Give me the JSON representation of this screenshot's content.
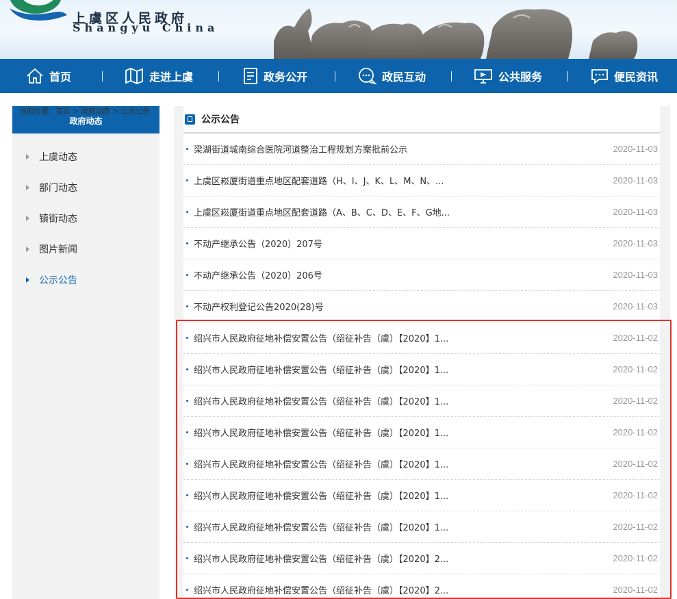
{
  "header": {
    "logo_cn": "上虞区人民政府",
    "logo_en": "Shangyu China"
  },
  "nav": {
    "items": [
      {
        "label": "首页",
        "icon": "home-icon"
      },
      {
        "label": "走进上虞",
        "icon": "map-icon"
      },
      {
        "label": "政务公开",
        "icon": "document-icon"
      },
      {
        "label": "政民互动",
        "icon": "chat-icon"
      },
      {
        "label": "公共服务",
        "icon": "monitor-icon"
      },
      {
        "label": "便民资讯",
        "icon": "message-icon"
      }
    ]
  },
  "breadcrumb": {
    "text": "当前位置：首页 > 政府动态 > 公示公告"
  },
  "sidebar": {
    "title": "政府动态",
    "items": [
      {
        "label": "上虞动态"
      },
      {
        "label": "部门动态"
      },
      {
        "label": "镇街动态"
      },
      {
        "label": "图片新闻"
      },
      {
        "label": "公示公告",
        "active": true
      }
    ]
  },
  "panel": {
    "title": "公示公告",
    "rows": [
      {
        "title": "梁湖街道城南综合医院河道整治工程规划方案批前公示",
        "date": "2020-11-03"
      },
      {
        "title": "上虞区崧厦街道重点地区配套道路（H、I、J、K、L、M、N、...",
        "date": "2020-11-03"
      },
      {
        "title": "上虞区崧厦街道重点地区配套道路（A、B、C、D、E、F、G地...",
        "date": "2020-11-03"
      },
      {
        "title": "不动产继承公告（2020）207号",
        "date": "2020-11-03"
      },
      {
        "title": "不动产继承公告（2020）206号",
        "date": "2020-11-03"
      },
      {
        "title": "不动产权利登记公告2020(28)号",
        "date": "2020-11-03"
      },
      {
        "title": "绍兴市人民政府征地补偿安置公告（绍征补告（虞）【2020】1...",
        "date": "2020-11-02"
      },
      {
        "title": "绍兴市人民政府征地补偿安置公告（绍征补告（虞）【2020】1...",
        "date": "2020-11-02"
      },
      {
        "title": "绍兴市人民政府征地补偿安置公告（绍征补告（虞）【2020】1...",
        "date": "2020-11-02"
      },
      {
        "title": "绍兴市人民政府征地补偿安置公告（绍征补告（虞）【2020】1...",
        "date": "2020-11-02"
      },
      {
        "title": "绍兴市人民政府征地补偿安置公告（绍征补告（虞）【2020】1...",
        "date": "2020-11-02"
      },
      {
        "title": "绍兴市人民政府征地补偿安置公告（绍征补告（虞）【2020】1...",
        "date": "2020-11-02"
      },
      {
        "title": "绍兴市人民政府征地补偿安置公告（绍征补告（虞）【2020】1...",
        "date": "2020-11-02"
      },
      {
        "title": "绍兴市人民政府征地补偿安置公告（绍征补告（虞）【2020】2...",
        "date": "2020-11-02"
      },
      {
        "title": "绍兴市人民政府征地补偿安置公告（绍征补告（虞）【2020】2...",
        "date": "2020-11-02"
      }
    ]
  },
  "colors": {
    "brand_blue": "#0d64ac",
    "highlight_red": "#e0302b"
  }
}
